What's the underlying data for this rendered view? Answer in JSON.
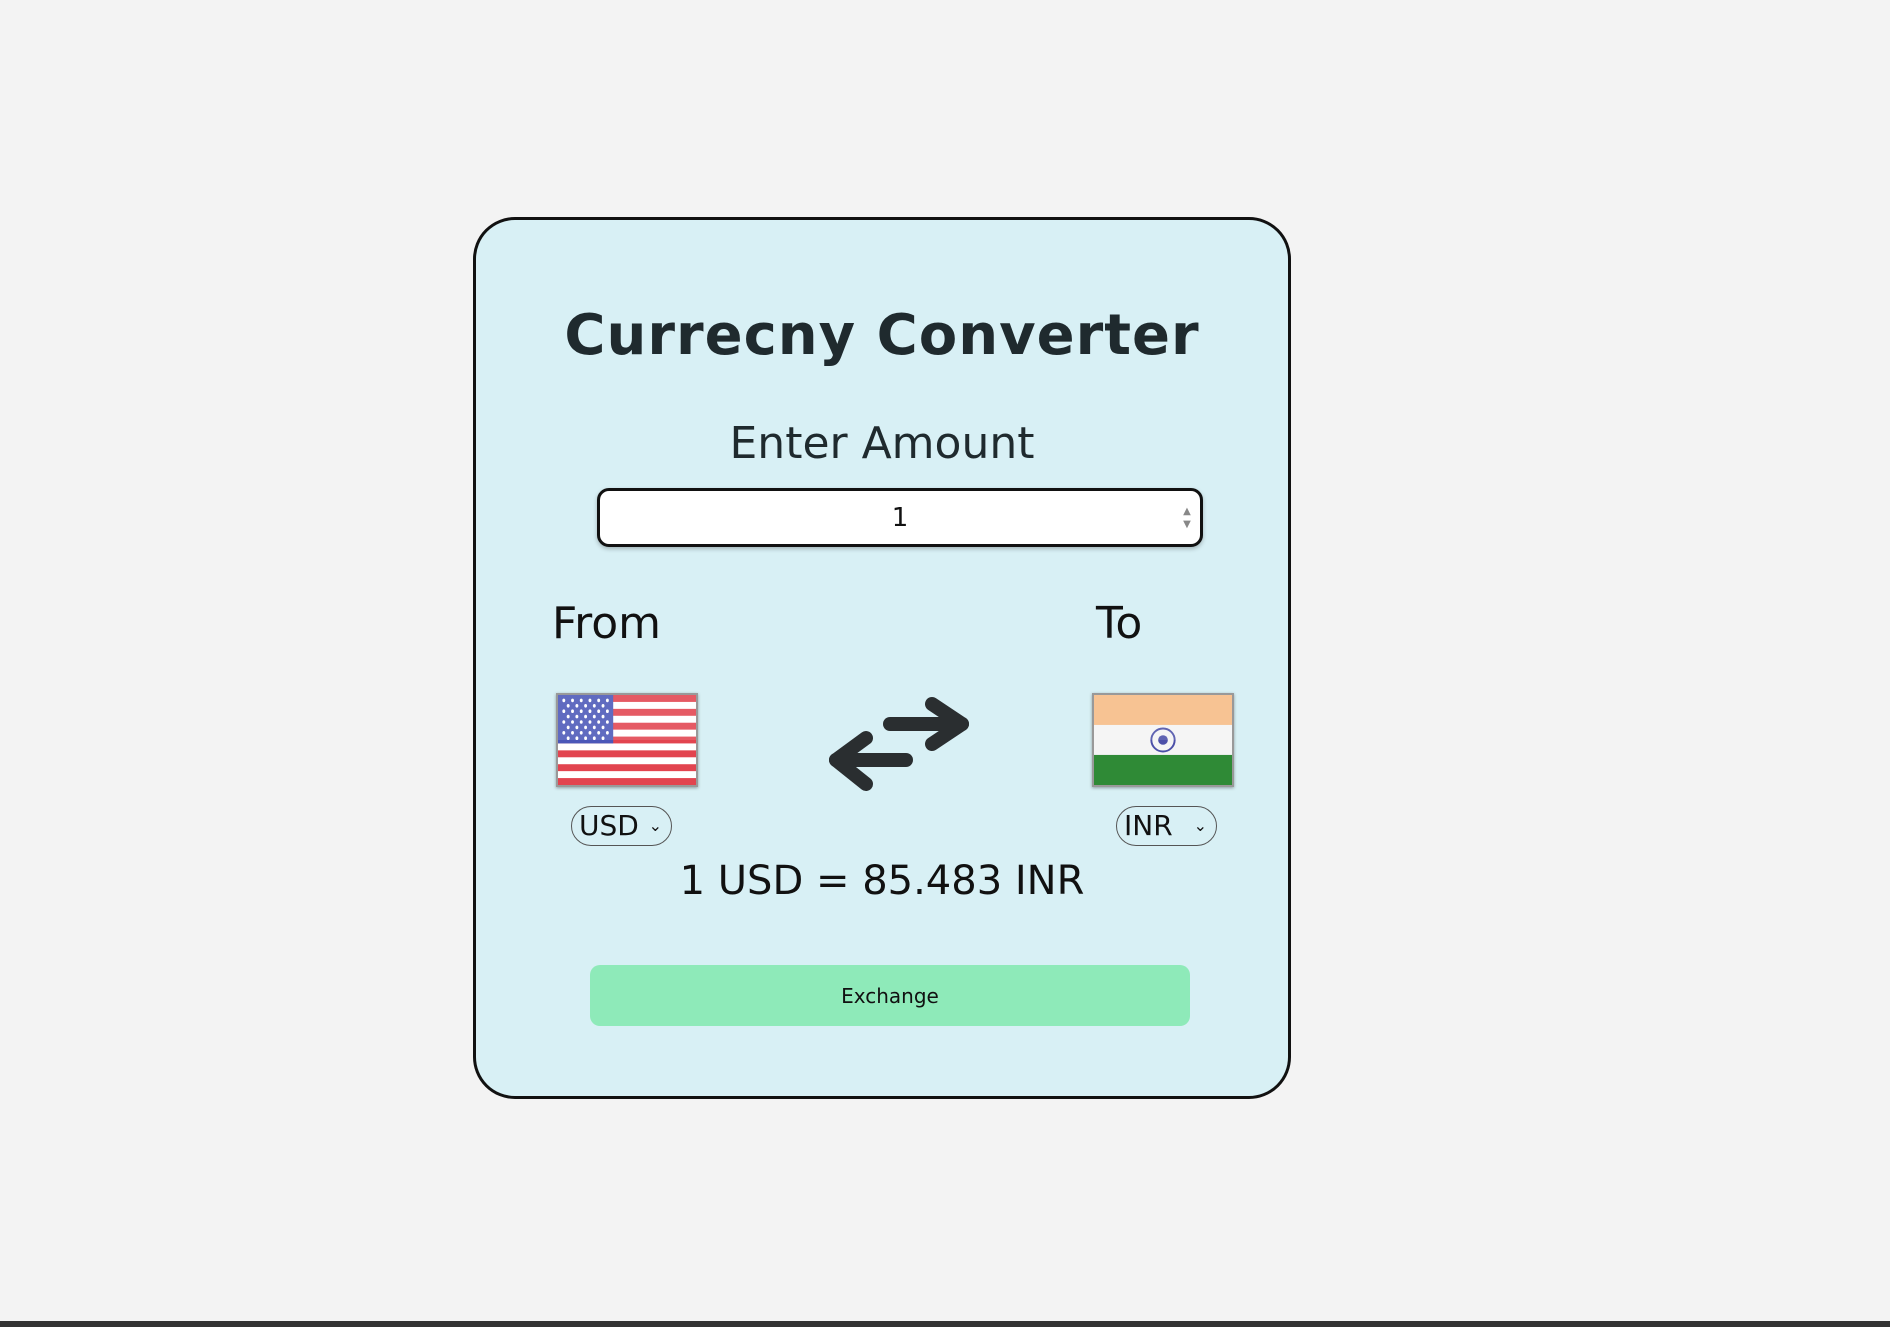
{
  "app": {
    "title": "Currecny Converter"
  },
  "amount": {
    "label": "Enter Amount",
    "value": "1"
  },
  "from": {
    "label": "From",
    "currency": "USD",
    "flag": "us-flag"
  },
  "to": {
    "label": "To",
    "currency": "INR",
    "flag": "india-flag"
  },
  "swap": {
    "icon": "swap-arrows-icon"
  },
  "result": {
    "text": "1 USD = 85.483 INR"
  },
  "actions": {
    "exchange_label": "Exchange"
  },
  "colors": {
    "page_background": "#f3f3f3",
    "card_background": "#d8f0f5",
    "button_background": "#8eeab9"
  }
}
